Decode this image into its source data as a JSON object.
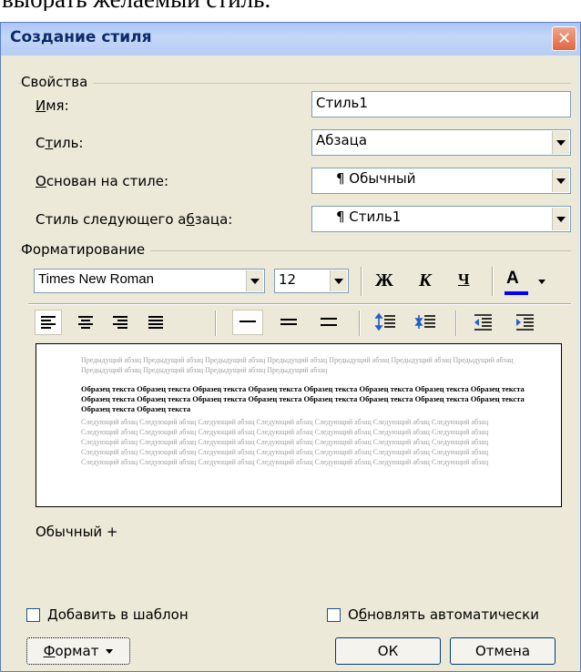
{
  "caption_top": "выбрать желаемый стиль.",
  "dialog": {
    "title": "Создание стиля",
    "close": "✕"
  },
  "properties": {
    "group_label": "Свойства",
    "name_label": "Имя:",
    "name_value": "Стиль1",
    "style_label": "Стиль:",
    "style_value": "Абзаца",
    "based_on_label": "Основан на стиле:",
    "based_on_value": "¶ Обычный",
    "next_label": "Стиль следующего абзаца:",
    "next_value": "¶ Стиль1"
  },
  "formatting": {
    "group_label": "Форматирование",
    "font": "Times New Roman",
    "size": "12",
    "bold": "Ж",
    "italic": "К",
    "underline": "Ч",
    "font_color": "А"
  },
  "preview": {
    "prev_text": "Предыдущий абзац Предыдущий абзац Предыдущий абзац Предыдущий абзац Предыдущий абзац Предыдущий абзац Предыдущий абзац Предыдущий абзац Предыдущий абзац Предыдущий абзац Предыдущий абзац",
    "current_text": "Образец текста Образец текста Образец текста Образец текста Образец текста Образец текста Образец текста Образец текста Образец текста Образец текста Образец текста Образец текста Образец текста Образец текста Образец текста Образец текста Образец текста Образец текста",
    "next_text": "Следующий абзац Следующий абзац Следующий абзац Следующий абзац Следующий абзац Следующий абзац Следующий абзац Следующий абзац Следующий абзац Следующий абзац Следующий абзац Следующий абзац Следующий абзац Следующий абзац Следующий абзац Следующий абзац Следующий абзац Следующий абзац Следующий абзац Следующий абзац Следующий абзац Следующий абзац Следующий абзац Следующий абзац Следующий абзац Следующий абзац Следующий абзац Следующий абзац Следующий абзац Следующий абзац Следующий абзац Следующий абзац Следующий абзац Следующий абзац Следующий абзац"
  },
  "description": "Обычный +",
  "add_to_template": "Добавить в шаблон",
  "auto_update": "Обновлять автоматически",
  "format_button": "Формат",
  "ok_button": "ОК",
  "cancel_button": "Отмена",
  "colors": {
    "dialog_bg": "#ece9d8",
    "title_text": "#0d2a6b",
    "font_color_bar": "#0000ff"
  }
}
